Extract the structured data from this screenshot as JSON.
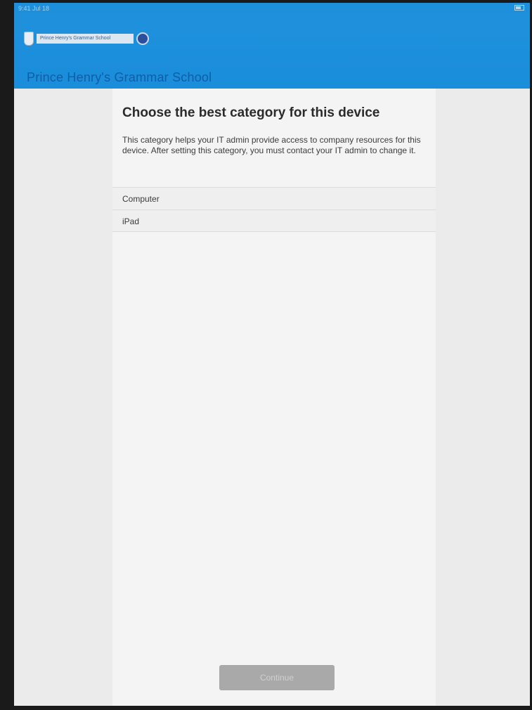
{
  "status_bar": {
    "time": "9:41 Jul 18"
  },
  "header": {
    "logo_text": "Prince Henry's Grammar School",
    "school_name": "Prince Henry's Grammar School"
  },
  "main": {
    "title": "Choose the best category for this device",
    "description": "This category helps your IT admin provide access to company resources for this device. After setting this category, you must contact your IT admin to change it.",
    "categories": [
      {
        "label": "Computer"
      },
      {
        "label": "iPad"
      }
    ],
    "continue_label": "Continue"
  },
  "colors": {
    "header_blue": "#1e8fdb",
    "school_name_text": "#0f5ea8",
    "button_disabled": "#a9a9a9"
  },
  "icons": [
    "school-crest-icon",
    "school-badge-icon",
    "battery-icon"
  ]
}
